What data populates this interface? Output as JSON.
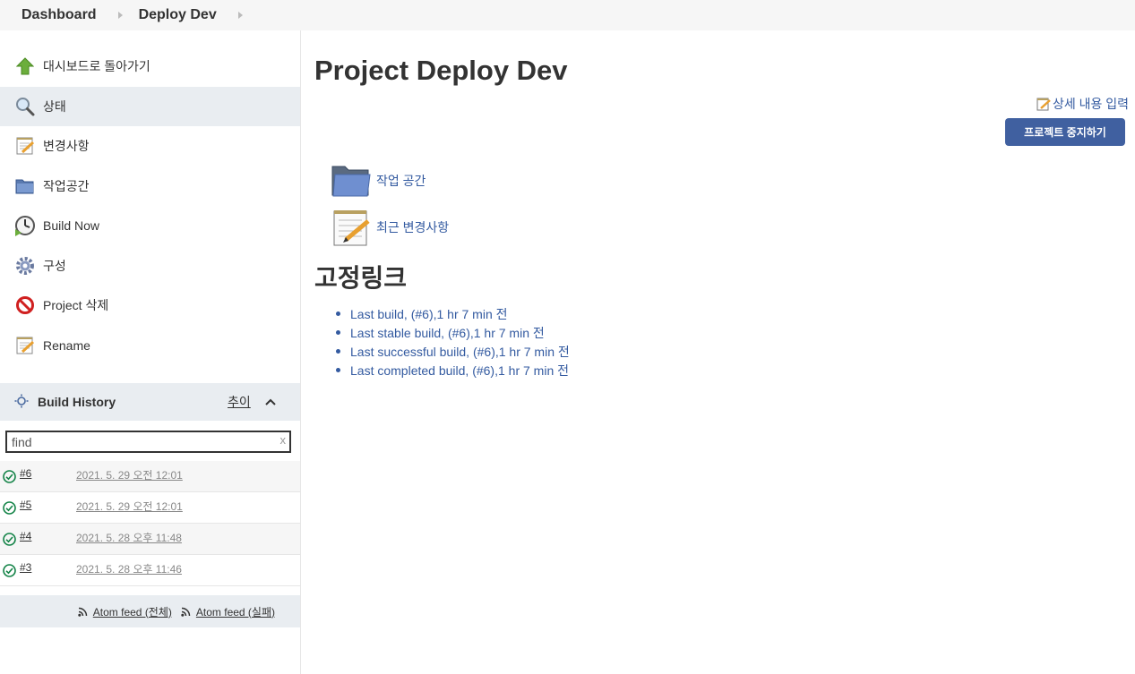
{
  "breadcrumb": {
    "items": [
      "Dashboard",
      "Deploy Dev"
    ]
  },
  "sidebar": {
    "tasks": [
      {
        "label": "대시보드로 돌아가기",
        "icon": "up-arrow-icon"
      },
      {
        "label": "상태",
        "icon": "search-icon"
      },
      {
        "label": "변경사항",
        "icon": "notepad-icon"
      },
      {
        "label": "작업공간",
        "icon": "folder-icon"
      },
      {
        "label": "Build Now",
        "icon": "clock-icon"
      },
      {
        "label": "구성",
        "icon": "gear-icon"
      },
      {
        "label": "Project 삭제",
        "icon": "no-entry-icon"
      },
      {
        "label": "Rename",
        "icon": "notepad-icon"
      }
    ]
  },
  "build_history": {
    "title": "Build History",
    "trend_label": "추이",
    "find_value": "find",
    "clear": "x",
    "builds": [
      {
        "number": "#6",
        "date": "2021. 5. 29 오전 12:01"
      },
      {
        "number": "#5",
        "date": "2021. 5. 29 오전 12:01"
      },
      {
        "number": "#4",
        "date": "2021. 5. 28 오후 11:48"
      },
      {
        "number": "#3",
        "date": "2021. 5. 28 오후 11:46"
      }
    ],
    "feeds": [
      "Atom feed (전체)",
      "Atom feed (실패)"
    ]
  },
  "main": {
    "title": "Project Deploy Dev",
    "edit_description": "상세 내용 입력",
    "disable_button": "프로젝트 중지하기",
    "links": [
      "작업 공간",
      "최근 변경사항"
    ],
    "permalinks_title": "고정링크",
    "permalinks": [
      "Last build, (#6),1 hr 7 min 전",
      "Last stable build, (#6),1 hr 7 min 전",
      "Last successful build, (#6),1 hr 7 min 전",
      "Last completed build, (#6),1 hr 7 min 전"
    ]
  },
  "colors": {
    "link": "#335aa0",
    "button": "#4060a0",
    "success": "#138347",
    "sidebar_active": "#e9edf1"
  }
}
